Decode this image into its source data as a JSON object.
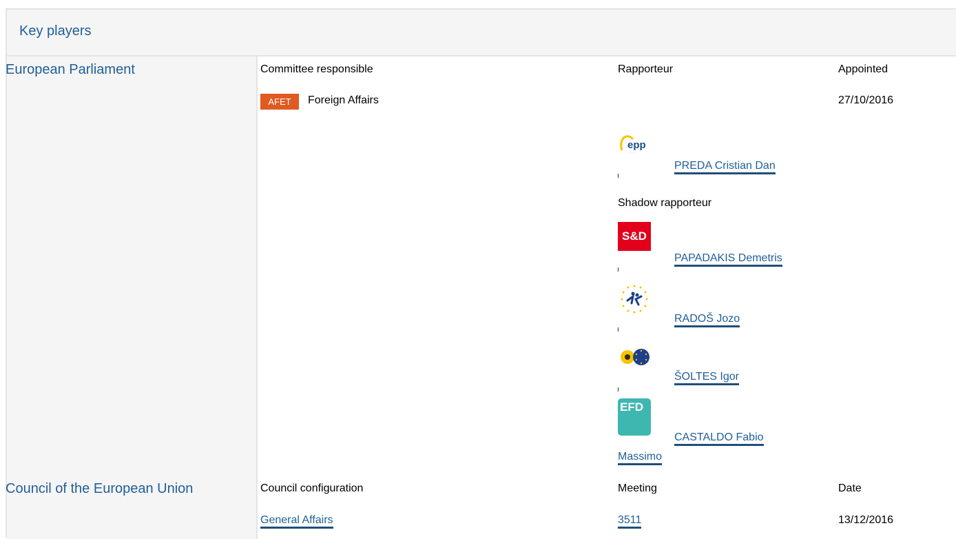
{
  "header": {
    "title": "Key players"
  },
  "parliament": {
    "institution": "European Parliament",
    "col_committee": "Committee responsible",
    "col_rapporteur": "Rapporteur",
    "col_appointed": "Appointed",
    "committee_code": "AFET",
    "committee_name": "Foreign Affairs",
    "appointed_date": "27/10/2016",
    "rapporteur": {
      "name": "PREDA Cristian Dan",
      "group_logo": "epp-logo",
      "group_text": "epp"
    },
    "shadow_label": "Shadow rapporteur",
    "shadows": [
      {
        "name": "PAPADAKIS Demetris",
        "group_logo": "sd-logo",
        "group_text": "S&D"
      },
      {
        "name": "RADOŠ Jozo",
        "group_logo": "alde-logo"
      },
      {
        "name": "ŠOLTES Igor",
        "group_logo": "greens-logo"
      },
      {
        "name_line1": "CASTALDO Fabio",
        "name_line2": "Massimo",
        "group_logo": "efdd-logo",
        "group_text": "EFD"
      }
    ]
  },
  "council": {
    "institution": "Council of the European Union",
    "col_configuration": "Council configuration",
    "col_meeting": "Meeting",
    "col_date": "Date",
    "configuration": "General Affairs",
    "meeting": "3511",
    "date": "13/12/2016"
  },
  "colors": {
    "link": "#1f5f99",
    "badge": "#e05a22",
    "panel_bg": "#f5f5f5",
    "border": "#e4e4e4"
  }
}
